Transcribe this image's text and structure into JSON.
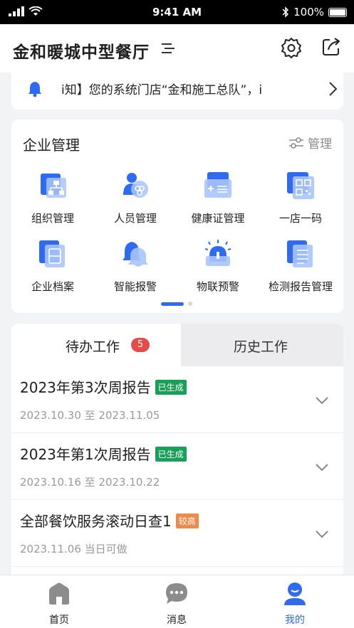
{
  "status_bar": {
    "time": "9:41 AM",
    "battery": "100%"
  },
  "header": {
    "title": "金和暖城中型餐厅"
  },
  "notice": {
    "text": "i知】您的系统门店“金和施工总队”，i"
  },
  "management": {
    "title": "企业管理",
    "manage_label": "管理",
    "items": [
      {
        "label": "组织管理",
        "icon": "org-structure-icon"
      },
      {
        "label": "人员管理",
        "icon": "people-icon"
      },
      {
        "label": "健康证管理",
        "icon": "health-cert-icon"
      },
      {
        "label": "一店一码",
        "icon": "qr-code-icon"
      },
      {
        "label": "企业档案",
        "icon": "archive-icon"
      },
      {
        "label": "智能报警",
        "icon": "alarm-bell-icon"
      },
      {
        "label": "物联预警",
        "icon": "iot-warning-icon"
      },
      {
        "label": "检测报告管理",
        "icon": "report-icon"
      }
    ],
    "page_indicator": {
      "pages": 2,
      "current": 1
    }
  },
  "tasks": {
    "tabs": [
      {
        "label": "待办工作",
        "badge": "5",
        "active": true
      },
      {
        "label": "历史工作",
        "active": false
      }
    ],
    "items": [
      {
        "title": "2023年第3次周报告",
        "tag": "已生成",
        "tag_color": "#19a058",
        "subtitle": "2023.10.30 至 2023.11.05"
      },
      {
        "title": "2023年第1次周报告",
        "tag": "已生成",
        "tag_color": "#19a058",
        "subtitle": "2023.10.16 至 2023.10.22"
      },
      {
        "title": "全部餐饮服务滚动日查1",
        "tag": "较高",
        "tag_color": "#f08a4b",
        "subtitle": "2023.11.06 当日可做"
      }
    ]
  },
  "bottom_nav": [
    {
      "label": "首页",
      "icon": "home-icon",
      "active": false
    },
    {
      "label": "消息",
      "icon": "message-icon",
      "active": false
    },
    {
      "label": "我的",
      "icon": "profile-icon",
      "active": true
    }
  ],
  "colors": {
    "accent": "#2f6bf0",
    "badge": "#e64b4b",
    "inactive_icon": "#8c8c8c"
  }
}
